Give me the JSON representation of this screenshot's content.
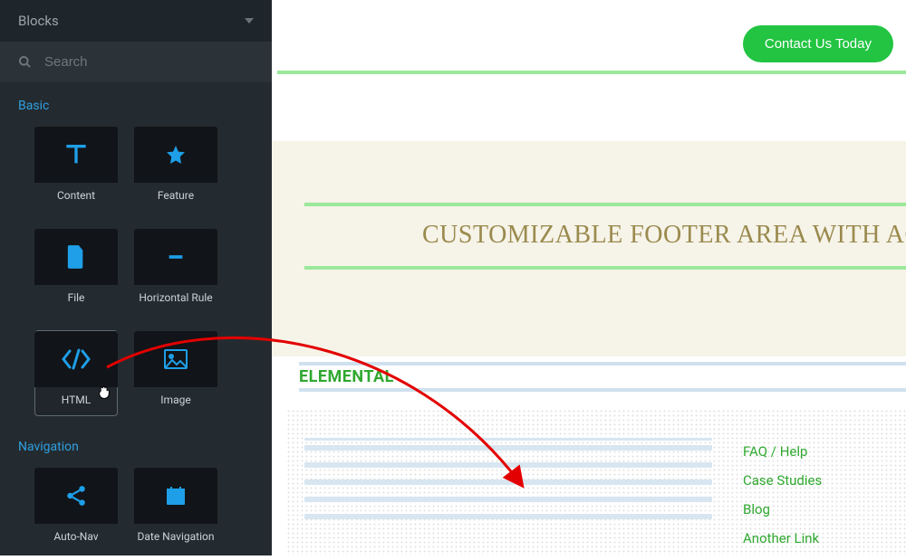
{
  "sidebar": {
    "title": "Blocks",
    "search_placeholder": "Search",
    "groups": [
      {
        "label": "Basic",
        "tiles": [
          {
            "name": "content",
            "label": "Content",
            "icon": "text"
          },
          {
            "name": "feature",
            "label": "Feature",
            "icon": "star"
          },
          {
            "name": "file",
            "label": "File",
            "icon": "file"
          },
          {
            "name": "hr",
            "label": "Horizontal Rule",
            "icon": "minus"
          },
          {
            "name": "html",
            "label": "HTML",
            "icon": "code",
            "selected": true
          },
          {
            "name": "image",
            "label": "Image",
            "icon": "image"
          }
        ]
      },
      {
        "label": "Navigation",
        "tiles": [
          {
            "name": "autonav",
            "label": "Auto-Nav",
            "icon": "share"
          },
          {
            "name": "datenav",
            "label": "Date Navigation",
            "icon": "calendar"
          }
        ]
      }
    ]
  },
  "canvas": {
    "cta_label": "Contact Us Today",
    "footer_heading": "CUSTOMIZABLE FOOTER AREA WITH ACC",
    "elemental_label": "ELEMENTAL",
    "links": [
      "FAQ / Help",
      "Case Studies",
      "Blog",
      "Another Link"
    ]
  },
  "colors": {
    "accent_blue": "#1e9fe8",
    "green_btn": "#22c442",
    "link_green": "#2fa82f",
    "gold": "#9a8a4e"
  }
}
